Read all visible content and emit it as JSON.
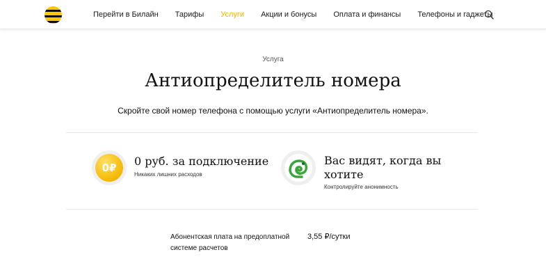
{
  "nav": {
    "items": [
      "Перейти в Билайн",
      "Тарифы",
      "Услуги",
      "Акции и бонусы",
      "Оплата и финансы",
      "Телефоны и гаджеты"
    ],
    "active": "Услуги"
  },
  "page": {
    "kicker": "Услуга",
    "title": "Антиопределитель номера",
    "subtitle": "Скройте свой номер телефона с помощью услуги «Антиопределитель номера»."
  },
  "features": [
    {
      "icon": "coin-zero-ruble-icon",
      "icon_text": "0₽",
      "title": "0 руб. за подключение",
      "sub": "Никаких лишних расходов"
    },
    {
      "icon": "chameleon-icon",
      "title_line1": "Вас видят, когда вы",
      "title_line2": "хотите",
      "sub": "Контролируйте анонимность"
    }
  ],
  "fee": {
    "label_line1": "Абонентская плата на предоплатной",
    "label_line2": "системе расчетов",
    "value": "3,55 ₽/сутки"
  },
  "colors": {
    "accent": "#f0b400",
    "brand_yellow": "#ffc800",
    "chameleon_green": "#3aa53a"
  }
}
